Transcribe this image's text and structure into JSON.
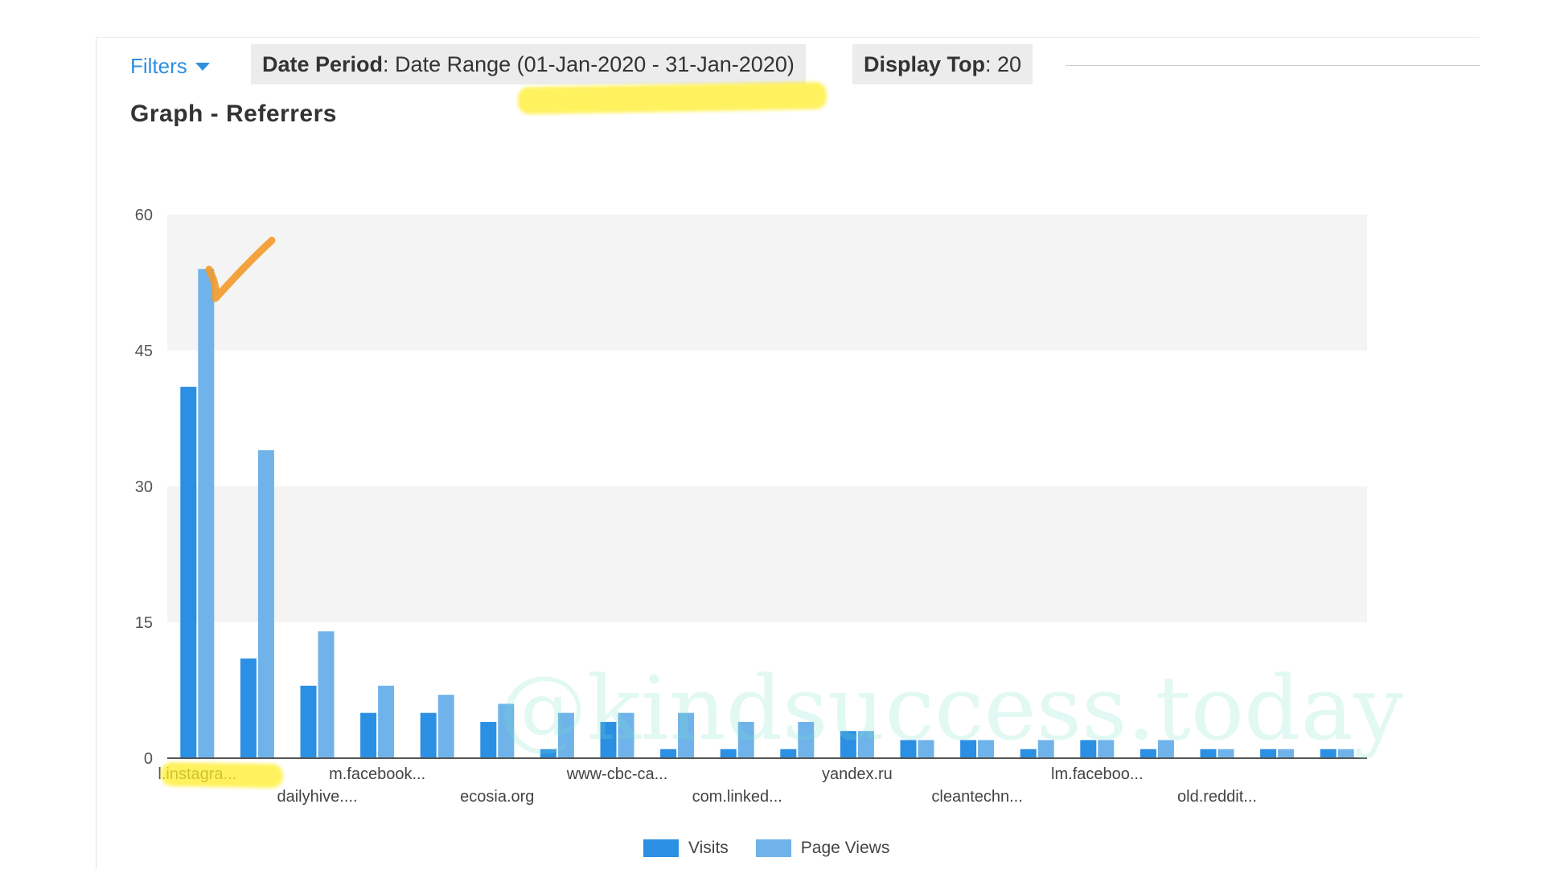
{
  "toolbar": {
    "filters_label": "Filters",
    "date_period_label": "Date Period",
    "date_period_value": ": Date Range (01-Jan-2020 - 31-Jan-2020)",
    "display_top_label": "Display Top",
    "display_top_value": ": 20"
  },
  "graph_title": "Graph - Referrers",
  "watermark": "@kindsuccess.today",
  "colors": {
    "visits": "#2b8fe3",
    "page_views": "#6fb3ea",
    "band": "#f4f4f4",
    "highlight": "#ffee28",
    "check": "#f39a2a"
  },
  "chart_data": {
    "type": "bar",
    "categories": [
      "l.instagra...",
      "",
      "dailyhive....",
      "m.facebook...",
      "",
      "ecosia.org",
      "",
      "www-cbc-ca...",
      "",
      "com.linked...",
      "",
      "yandex.ru",
      "",
      "cleantechn...",
      "",
      "lm.faceboo...",
      "",
      "old.reddit...",
      "",
      ""
    ],
    "series": [
      {
        "name": "Visits",
        "values": [
          41,
          11,
          8,
          5,
          5,
          4,
          1,
          4,
          1,
          1,
          1,
          3,
          2,
          2,
          1,
          2,
          1,
          1,
          1,
          1
        ]
      },
      {
        "name": "Page Views",
        "values": [
          54,
          34,
          14,
          8,
          7,
          6,
          5,
          5,
          5,
          4,
          4,
          3,
          2,
          2,
          2,
          2,
          2,
          1,
          1,
          1
        ]
      }
    ],
    "ylim": [
      0,
      60
    ],
    "yticks": [
      0,
      15,
      30,
      45,
      60
    ],
    "grid": "alternating bands",
    "legend": "bottom-center"
  }
}
